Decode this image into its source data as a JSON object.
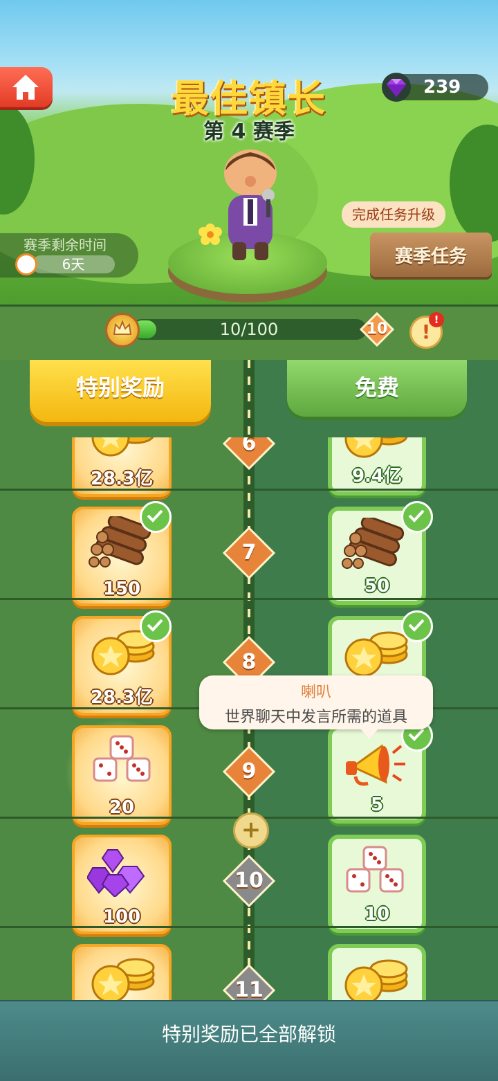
{
  "header": {
    "title": "最佳镇长",
    "season": "第 4 赛季",
    "gems": "239",
    "season_time_label": "赛季剩余时间",
    "season_time_value": "6天",
    "task_bubble": "完成任务升级",
    "task_button": "赛季任务"
  },
  "progress": {
    "text": "10/100",
    "fraction": 0.1,
    "level": "10",
    "info_icon": "!",
    "alert_badge": "!"
  },
  "tabs": {
    "special": "特别奖励",
    "free": "免费"
  },
  "rows": [
    {
      "level": "6",
      "special": {
        "amount": "28.3亿",
        "item": "coins-icon",
        "claimed": false
      },
      "free": {
        "amount": "9.4亿",
        "item": "coins-icon",
        "claimed": false
      }
    },
    {
      "level": "7",
      "special": {
        "amount": "150",
        "item": "logs-icon",
        "claimed": true
      },
      "free": {
        "amount": "50",
        "item": "logs-icon",
        "claimed": true
      }
    },
    {
      "level": "8",
      "special": {
        "amount": "28.3亿",
        "item": "coins-icon",
        "claimed": true
      },
      "free": {
        "amount": "",
        "item": "coins-icon",
        "claimed": true
      }
    },
    {
      "level": "9",
      "special": {
        "amount": "20",
        "item": "dice-icon",
        "claimed": false
      },
      "free": {
        "amount": "5",
        "item": "megaphone-icon",
        "claimed": true
      }
    },
    {
      "level": "10",
      "special": {
        "amount": "100",
        "item": "gems-icon",
        "claimed": false
      },
      "free": {
        "amount": "10",
        "item": "dice-icon",
        "claimed": false
      }
    },
    {
      "level": "11",
      "special": {
        "amount": "",
        "item": "coins-icon",
        "claimed": false
      },
      "free": {
        "amount": "",
        "item": "coins-icon",
        "claimed": false
      }
    }
  ],
  "tooltip": {
    "title": "喇叭",
    "description": "世界聊天中发言所需的道具"
  },
  "plus_label": "+",
  "footer": {
    "message": "特别奖励已全部解锁"
  },
  "colors": {
    "accent_gold": "#f5a623",
    "free_green": "#7ecb56",
    "diamond_orange": "#e8833a",
    "locked_gray": "#8a8a8a"
  }
}
